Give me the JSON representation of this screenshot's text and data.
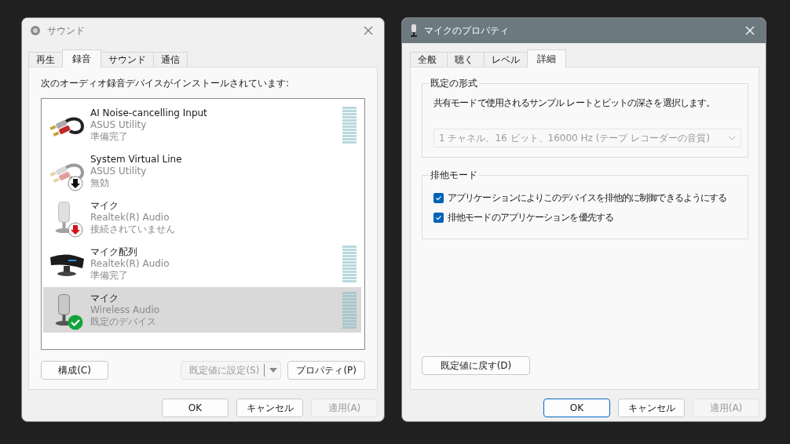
{
  "sound_window": {
    "title": "サウンド",
    "active": false,
    "tabs": [
      {
        "label": "再生",
        "selected": false
      },
      {
        "label": "録音",
        "selected": true
      },
      {
        "label": "サウンド",
        "selected": false
      },
      {
        "label": "通信",
        "selected": false
      }
    ],
    "prompt": "次のオーディオ録音デバイスがインストールされています:",
    "devices": [
      {
        "name": "AI Noise-cancelling Input",
        "driver": "ASUS Utility",
        "status": "準備完了",
        "kind": "cable",
        "meter": true,
        "selected": false
      },
      {
        "name": "System Virtual Line",
        "driver": "ASUS Utility",
        "status": "無効",
        "kind": "cabledisabled",
        "meter": false,
        "selected": false
      },
      {
        "name": "マイク",
        "driver": "Realtek(R) Audio",
        "status": "接続されていません",
        "kind": "micunplugged",
        "meter": false,
        "selected": false
      },
      {
        "name": "マイク配列",
        "driver": "Realtek(R) Audio",
        "status": "準備完了",
        "kind": "array",
        "meter": true,
        "selected": false
      },
      {
        "name": "マイク",
        "driver": "Wireless Audio",
        "status": "既定のデバイス",
        "kind": "micdefault",
        "meter": true,
        "selected": true
      }
    ],
    "buttons": [
      {
        "label": "構成(C)",
        "kind": "normal",
        "disabled": false
      },
      {
        "label": "既定値に設定(S)",
        "kind": "split",
        "disabled": true
      },
      {
        "label": "プロパティ(P)",
        "kind": "normal",
        "disabled": false
      }
    ],
    "footer": [
      {
        "label": "OK",
        "default": false,
        "disabled": false
      },
      {
        "label": "キャンセル",
        "default": false,
        "disabled": false
      },
      {
        "label": "適用(A)",
        "default": false,
        "disabled": true
      }
    ]
  },
  "properties_window": {
    "title": "マイクのプロパティ",
    "active": true,
    "tabs": [
      {
        "label": "全般",
        "selected": false
      },
      {
        "label": "聴く",
        "selected": false
      },
      {
        "label": "レベル",
        "selected": false
      },
      {
        "label": "詳細",
        "selected": true
      }
    ],
    "default_format": {
      "legend": "既定の形式",
      "description": "共有モードで使用されるサンプル レートとビットの深さを選択します。",
      "select": {
        "value": "1 チャネル、16 ビット、16000 Hz (テープ レコーダーの音質)",
        "disabled": true
      }
    },
    "exclusive_mode": {
      "legend": "排他モード",
      "options": [
        {
          "label": "アプリケーションによりこのデバイスを排他的に制御できるようにする",
          "checked": true
        },
        {
          "label": "排他モードのアプリケーションを優先する",
          "checked": true
        }
      ]
    },
    "reset_button": {
      "label": "既定値に戻す(D)",
      "disabled": false
    },
    "footer": [
      {
        "label": "OK",
        "default": true,
        "disabled": false
      },
      {
        "label": "キャンセル",
        "default": false,
        "disabled": false
      },
      {
        "label": "適用(A)",
        "default": false,
        "disabled": true
      }
    ]
  }
}
